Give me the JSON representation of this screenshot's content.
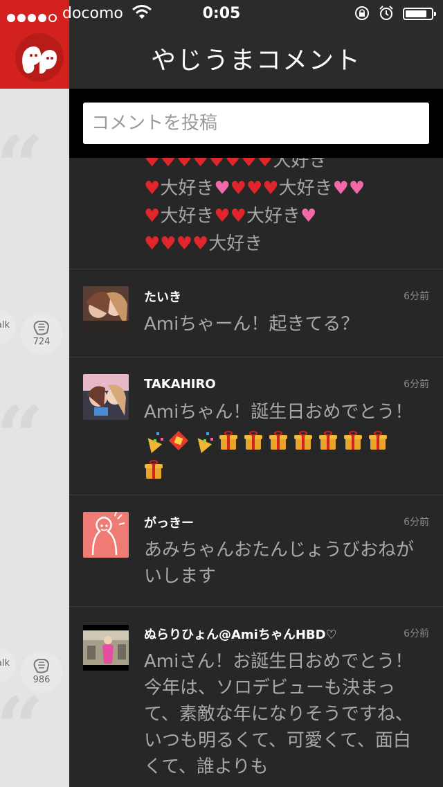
{
  "status_bar": {
    "carrier": "docomo",
    "time": "0:05",
    "signal_dots_filled": 4,
    "signal_dots_total": 5,
    "icons": [
      "wifi-icon",
      "orientation-lock-icon",
      "alarm-icon",
      "battery-icon"
    ]
  },
  "header": {
    "title": "やじうまコメント"
  },
  "comment_input": {
    "placeholder": "コメントを投稿"
  },
  "top_comment": {
    "line_texts": [
      "大好き",
      "大好き",
      "大好き",
      "大好き",
      "大好き",
      "大好き"
    ]
  },
  "comments": [
    {
      "name": "たいき",
      "time_ago": "6分前",
      "text": "Amiちゃーん！起きてる？"
    },
    {
      "name": "TAKAHIRO",
      "time_ago": "6分前",
      "text": "Amiちゃん！誕生日おめでとう！"
    },
    {
      "name": "がっきー",
      "time_ago": "6分前",
      "text": "あみちゃんおたんじょうびおねがいします"
    },
    {
      "name": "ぬらりひょん@AmiちゃんHBD♡",
      "time_ago": "6分前",
      "text": "Amiさん！お誕生日おめでとう！今年は、ソロデビューも決まって、素敵な年になりそうですね、いつも明るくて、可愛くて、面白くて、誰よりも"
    }
  ],
  "sidebar": {
    "items": [
      {
        "talk_label": "alk",
        "clap_count": "724"
      },
      {
        "talk_label": "alk",
        "clap_count": "986"
      }
    ]
  },
  "colors": {
    "brand_red": "#d3221d",
    "panel_bg": "#272727",
    "header_bg": "#2d2b29",
    "sidebar_bg": "#e4e4e4",
    "text_secondary": "#a8a8a8"
  }
}
